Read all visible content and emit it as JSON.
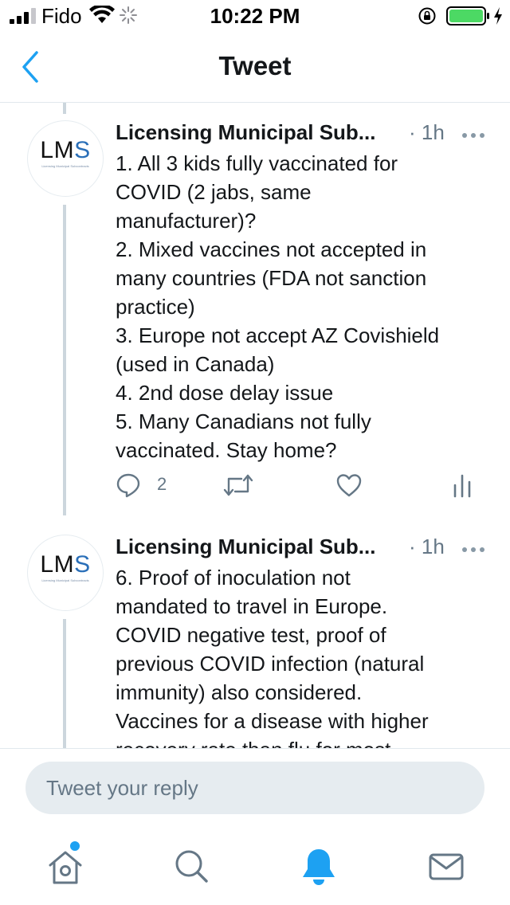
{
  "status": {
    "carrier": "Fido",
    "time": "10:22 PM",
    "battery_color": "#4cd964"
  },
  "nav": {
    "title": "Tweet",
    "back_icon": "chevron-left-icon",
    "accent_color": "#1da1f2"
  },
  "tweets": [
    {
      "avatar_text": "LM",
      "avatar_text_accent": "S",
      "avatar_subtext": "Licensing Municipal Subcontracts",
      "name": "Licensing Municipal Sub...",
      "time": "· 1h",
      "lines": [
        "1. All 3 kids fully vaccinated for",
        "COVID (2 jabs, same",
        "manufacturer)?",
        "2. Mixed vaccines not accepted in",
        "many countries (FDA not sanction",
        "practice)",
        "3. Europe not accept AZ Covishield",
        "(used in Canada)",
        "4. 2nd dose delay issue",
        "5. Many Canadians not fully",
        "vaccinated. Stay home?"
      ],
      "reply_count": "2"
    },
    {
      "avatar_text": "LM",
      "avatar_text_accent": "S",
      "avatar_subtext": "Licensing Municipal Subcontracts",
      "name": "Licensing Municipal Sub...",
      "time": "· 1h",
      "lines": [
        "6. Proof of inoculation not",
        "mandated to travel in Europe.",
        "COVID negative test, proof of",
        "previous COVID infection (natural",
        "immunity) also considered.",
        "Vaccines for a disease with higher",
        "recovery rate than flu for most"
      ]
    }
  ],
  "reply": {
    "placeholder": "Tweet your reply"
  },
  "tabs": [
    {
      "icon": "home-icon",
      "active": false,
      "has_notification_dot": true
    },
    {
      "icon": "search-icon",
      "active": false
    },
    {
      "icon": "notifications-bell-icon",
      "active": true
    },
    {
      "icon": "messages-envelope-icon",
      "active": false
    }
  ]
}
